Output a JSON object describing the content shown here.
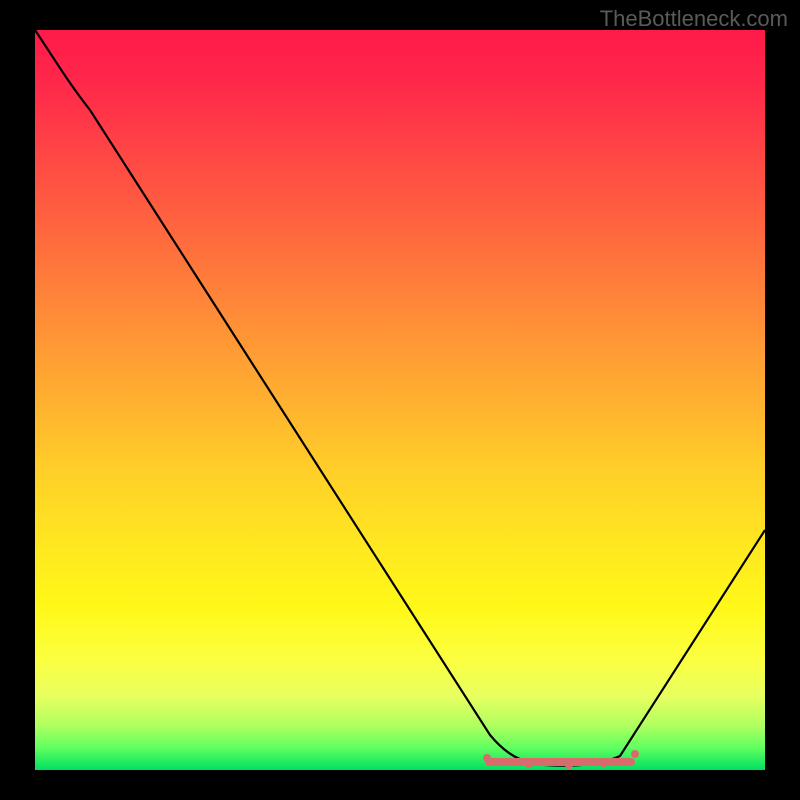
{
  "watermark": "TheBottleneck.com",
  "chart_data": {
    "type": "line",
    "title": "",
    "xlabel": "",
    "ylabel": "",
    "xlim": [
      0,
      100
    ],
    "ylim": [
      0,
      100
    ],
    "grid": false,
    "legend": false,
    "series": [
      {
        "name": "bottleneck-curve",
        "x": [
          0,
          5,
          10,
          15,
          20,
          25,
          30,
          35,
          40,
          45,
          50,
          55,
          60,
          62,
          65,
          68,
          72,
          76,
          80,
          85,
          90,
          95,
          100
        ],
        "y": [
          100,
          97,
          91,
          84,
          77,
          70,
          63,
          55,
          47,
          39,
          31,
          23,
          15,
          10,
          6,
          3,
          1,
          0.5,
          1,
          5,
          12,
          22,
          35
        ]
      }
    ],
    "highlight_region": {
      "name": "optimal-band",
      "x_start": 62,
      "x_end": 82,
      "y": 1,
      "color": "#d86b6b"
    },
    "background_gradient": {
      "stops": [
        {
          "pos": 0,
          "color": "#ff1a4a"
        },
        {
          "pos": 50,
          "color": "#ffb030"
        },
        {
          "pos": 80,
          "color": "#fff818"
        },
        {
          "pos": 100,
          "color": "#00e060"
        }
      ]
    }
  }
}
